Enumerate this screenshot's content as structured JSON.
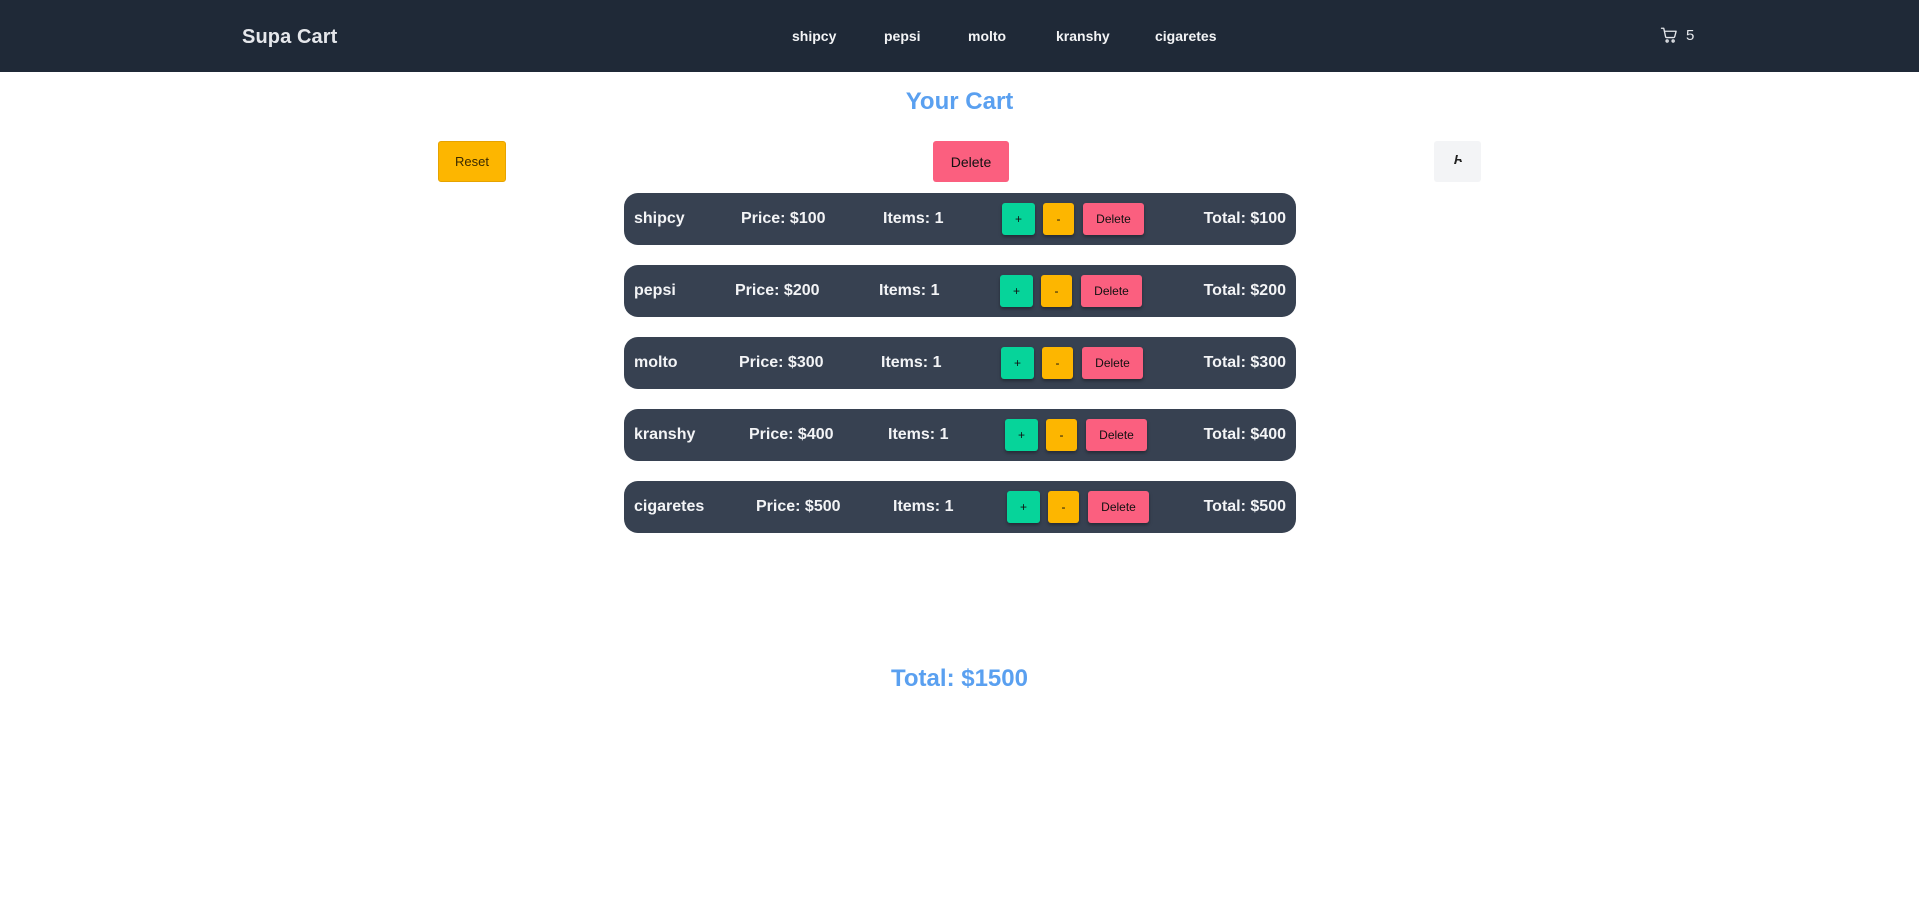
{
  "header": {
    "brand": "Supa Cart",
    "nav": [
      "shipcy",
      "pepsi",
      "molto",
      "kranshy",
      "cigaretes"
    ],
    "cart_count": "5",
    "cart_icon": "shopping-cart-icon",
    "bg_color": "#1f2937"
  },
  "page": {
    "title": "Your Cart",
    "reset_label": "Reset",
    "delete_label": "Delete",
    "theme_icon": "theme-toggle-icon",
    "grand_total": "Total: $1500"
  },
  "items": [
    {
      "name": "shipcy",
      "price": "Price: $100",
      "items": "Items: 1",
      "plus": "+",
      "minus": "-",
      "delete": "Delete",
      "total": "Total: $100"
    },
    {
      "name": "pepsi",
      "price": "Price: $200",
      "items": "Items: 1",
      "plus": "+",
      "minus": "-",
      "delete": "Delete",
      "total": "Total: $200"
    },
    {
      "name": "molto",
      "price": "Price: $300",
      "items": "Items: 1",
      "plus": "+",
      "minus": "-",
      "delete": "Delete",
      "total": "Total: $300"
    },
    {
      "name": "kranshy",
      "price": "Price: $400",
      "items": "Items: 1",
      "plus": "+",
      "minus": "-",
      "delete": "Delete",
      "total": "Total: $400"
    },
    {
      "name": "cigaretes",
      "price": "Price: $500",
      "items": "Items: 1",
      "plus": "+",
      "minus": "-",
      "delete": "Delete",
      "total": "Total: $500"
    }
  ],
  "colors": {
    "accent": "#5aa0f0",
    "row_bg": "#374151",
    "plus": "#06d49a",
    "minus": "#fdb600",
    "delete": "#fb5f7f"
  }
}
